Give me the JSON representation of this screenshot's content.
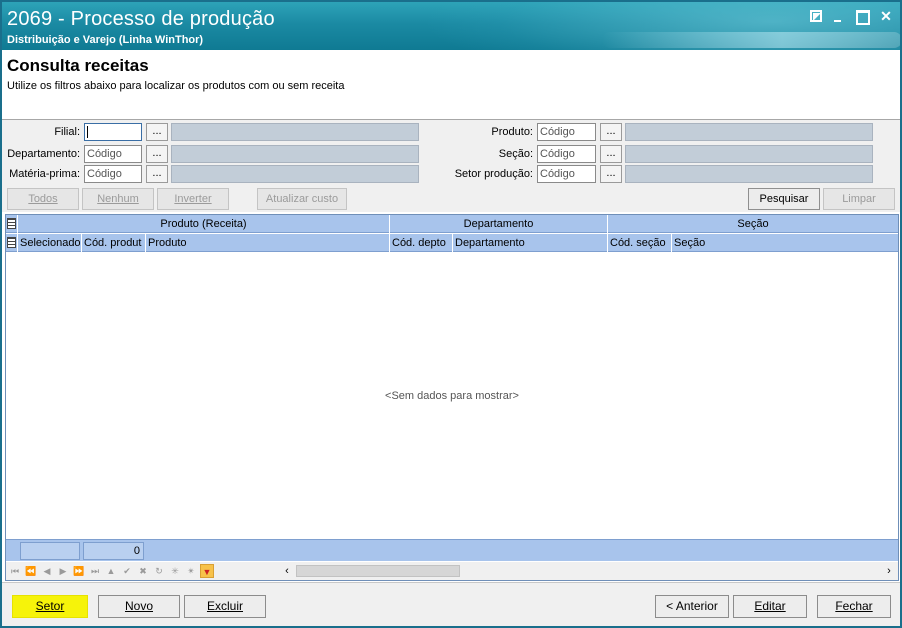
{
  "window": {
    "title": "2069 - Processo de produção",
    "subtitle": "Distribuição e Varejo (Linha WinThor)"
  },
  "header": {
    "title": "Consulta receitas",
    "subtitle": "Utilize os filtros abaixo para localizar os produtos com ou sem receita"
  },
  "filters": {
    "filial": {
      "label": "Filial:",
      "value": ""
    },
    "departamento": {
      "label": "Departamento:",
      "placeholder": "Código"
    },
    "materia_prima": {
      "label": "Matéria-prima:",
      "placeholder": "Código"
    },
    "produto": {
      "label": "Produto:",
      "placeholder": "Código"
    },
    "secao": {
      "label": "Seção:",
      "placeholder": "Código"
    },
    "setor_producao": {
      "label": "Setor produção:",
      "placeholder": "Código"
    },
    "lookup_label": "..."
  },
  "toolbar": {
    "todos": "Todos",
    "nenhum": "Nenhum",
    "inverter": "Inverter",
    "atualizar_custo": "Atualizar custo",
    "pesquisar": "Pesquisar",
    "limpar": "Limpar"
  },
  "grid": {
    "bands": [
      "Produto (Receita)",
      "Departamento",
      "Seção"
    ],
    "columns": [
      "Selecionado",
      "Cód. produt",
      "Produto",
      "Cód. depto",
      "Departamento",
      "Cód. seção",
      "Seção"
    ],
    "empty_message": "<Sem dados para mostrar>",
    "summary_count": "0"
  },
  "bottom": {
    "setor": "Setor",
    "novo": "Novo",
    "excluir": "Excluir",
    "anterior": "< Anterior",
    "editar": "Editar",
    "fechar": "Fechar"
  },
  "colors": {
    "titlebar": "#1b8aa3",
    "grid_header": "#a8c4ec",
    "highlight": "#f6f30a"
  }
}
